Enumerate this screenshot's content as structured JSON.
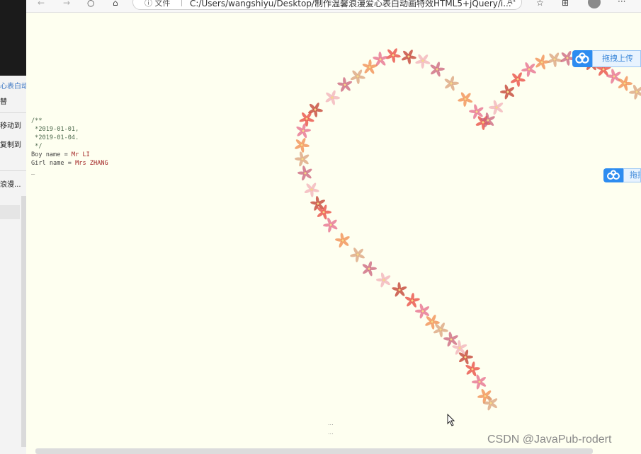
{
  "explorer": {
    "item_top": "心表白动",
    "item_partial": "替",
    "move_to": "移动到",
    "copy_to": "复制到",
    "file_item": "浪漫..."
  },
  "browser": {
    "info_label": "ⓘ 文件",
    "url": "C:/Users/wangshiyu/Desktop/制作温馨浪漫爱心表白动画特效HTML5+jQuery/i...",
    "read_aloud": "A⁴",
    "more": "···"
  },
  "code": {
    "line1": "/**",
    "line2": " *2019-01-01,",
    "line3": " *2019-01-04.",
    "line4": " */",
    "boy_key": "Boy name = ",
    "boy_value": "Mr LI",
    "girl_key": "Girl name = ",
    "girl_value": "Mrs ZHANG",
    "cursor": "_"
  },
  "upload_widget": {
    "label_full": "拖拽上传",
    "label_partial": "拖拽"
  },
  "footer": {
    "dots": "...",
    "watermark": "CSDN @JavaPub-rodert"
  },
  "colors": {
    "page_bg": "#fefff0",
    "petal_palette": [
      "#e8453c",
      "#e56a8a",
      "#f08a4b",
      "#d9a07a",
      "#c9607a",
      "#f2b0b8",
      "#c0392b"
    ]
  }
}
